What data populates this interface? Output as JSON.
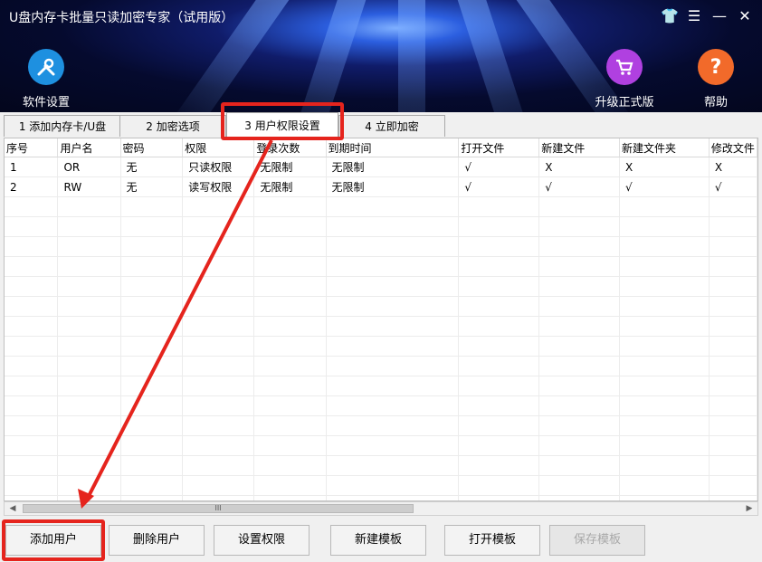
{
  "window": {
    "title": "U盘内存卡批量只读加密专家（试用版）",
    "controls": [
      "shirt-icon",
      "menu-icon",
      "minimize-icon",
      "close-icon"
    ]
  },
  "toolbar": {
    "settings_label": "软件设置",
    "upgrade_label": "升级正式版",
    "help_label": "帮助",
    "help_glyph": "?"
  },
  "tabs": [
    {
      "label": "1 添加内存卡/U盘"
    },
    {
      "label": "2 加密选项"
    },
    {
      "label": "3 用户权限设置"
    },
    {
      "label": "4 立即加密"
    }
  ],
  "table": {
    "columns": [
      "序号",
      "用户名",
      "密码",
      "权限",
      "登录次数",
      "到期时间",
      "打开文件",
      "新建文件",
      "新建文件夹",
      "修改文件"
    ],
    "rows": [
      [
        "1",
        "OR",
        "无",
        "只读权限",
        "无限制",
        "无限制",
        "√",
        "X",
        "X",
        "X"
      ],
      [
        "2",
        "RW",
        "无",
        "读写权限",
        "无限制",
        "无限制",
        "√",
        "√",
        "√",
        "√"
      ]
    ],
    "scrollbar_grip": "III"
  },
  "buttons": {
    "add_user": "添加用户",
    "delete_user": "删除用户",
    "set_permission": "设置权限",
    "new_template": "新建模板",
    "open_template": "打开模板",
    "save_template": "保存模板"
  },
  "colors": {
    "highlight": "#e5241d",
    "settings_icon": "#1e90e0",
    "upgrade_icon": "#b040e0",
    "help_icon": "#f26a2a"
  }
}
